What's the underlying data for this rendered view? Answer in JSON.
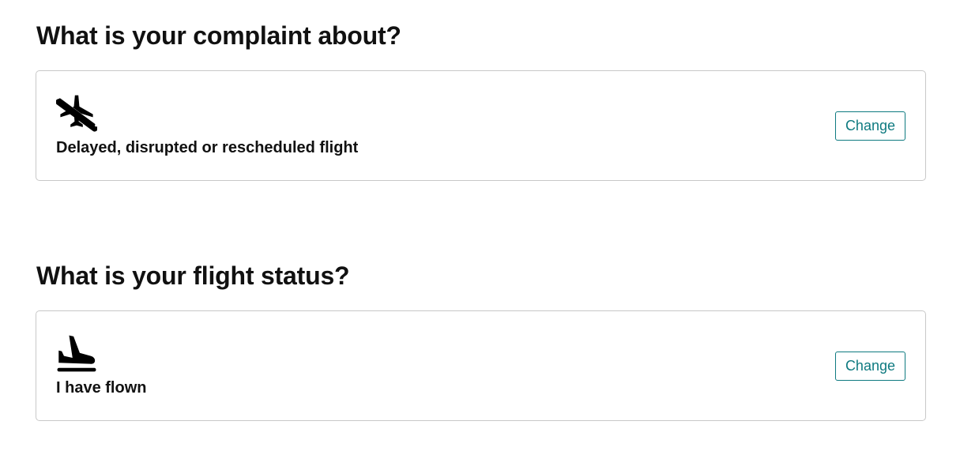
{
  "complaint": {
    "question": "What is your complaint about?",
    "icon": "airplane-off-icon",
    "answer": "Delayed, disrupted or rescheduled flight",
    "change_label": "Change"
  },
  "flight_status": {
    "question": "What is your flight status?",
    "icon": "airplane-landing-icon",
    "answer": "I have flown",
    "change_label": "Change"
  },
  "colors": {
    "accent": "#0e7a80",
    "card_border": "#c8c8c8",
    "text": "#111111"
  }
}
